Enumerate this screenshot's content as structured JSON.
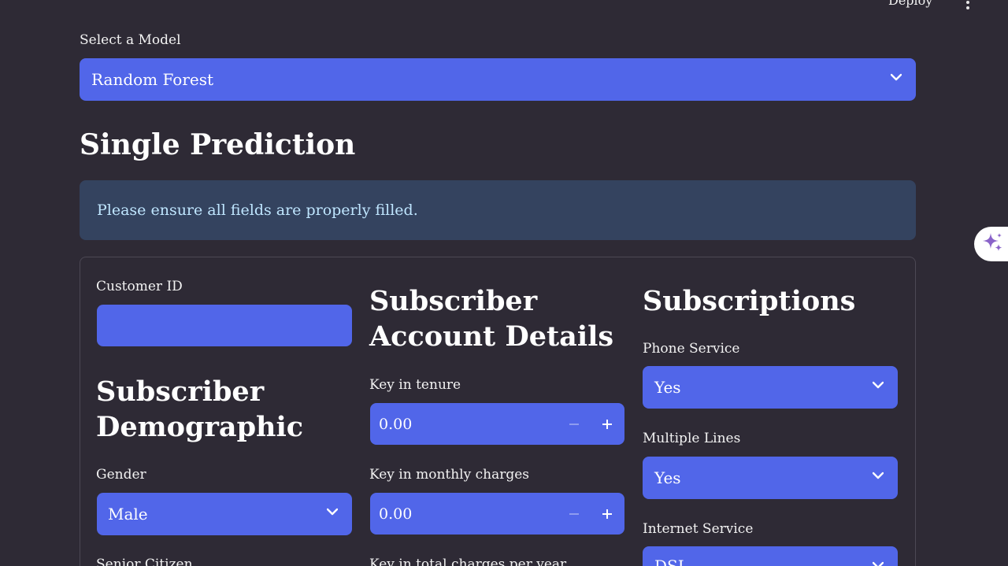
{
  "header": {
    "deploy_label": "Deploy"
  },
  "model": {
    "label": "Select a Model",
    "selected": "Random Forest"
  },
  "heading": "Single Prediction",
  "info_message": "Please ensure all fields are properly filled.",
  "form": {
    "customer_id": {
      "label": "Customer ID",
      "value": ""
    },
    "demographic": {
      "title_line1": "Subscriber",
      "title_line2": "Demographic",
      "gender_label": "Gender",
      "gender_value": "Male",
      "senior_label": "Senior Citizen"
    },
    "account": {
      "title_line1": "Subscriber",
      "title_line2": "Account Details",
      "tenure_label": "Key in tenure",
      "tenure_value": "0.00",
      "monthly_label": "Key in monthly charges",
      "monthly_value": "0.00",
      "total_label": "Key in total charges per year"
    },
    "subscriptions": {
      "title": "Subscriptions",
      "phone_label": "Phone Service",
      "phone_value": "Yes",
      "lines_label": "Multiple Lines",
      "lines_value": "Yes",
      "internet_label": "Internet Service",
      "internet_value": "DSL"
    }
  },
  "icons": {
    "dropdown": "chevron-down-icon",
    "menu": "kebab-menu-icon",
    "assistant": "sparkles-icon",
    "increment": "plus-icon",
    "decrement": "minus-icon"
  },
  "colors": {
    "background": "#2e2a35",
    "accent": "#5166e9",
    "info_bg": "#34435f",
    "info_text": "#bfe6ff",
    "sparkle": "#8a63c9"
  }
}
